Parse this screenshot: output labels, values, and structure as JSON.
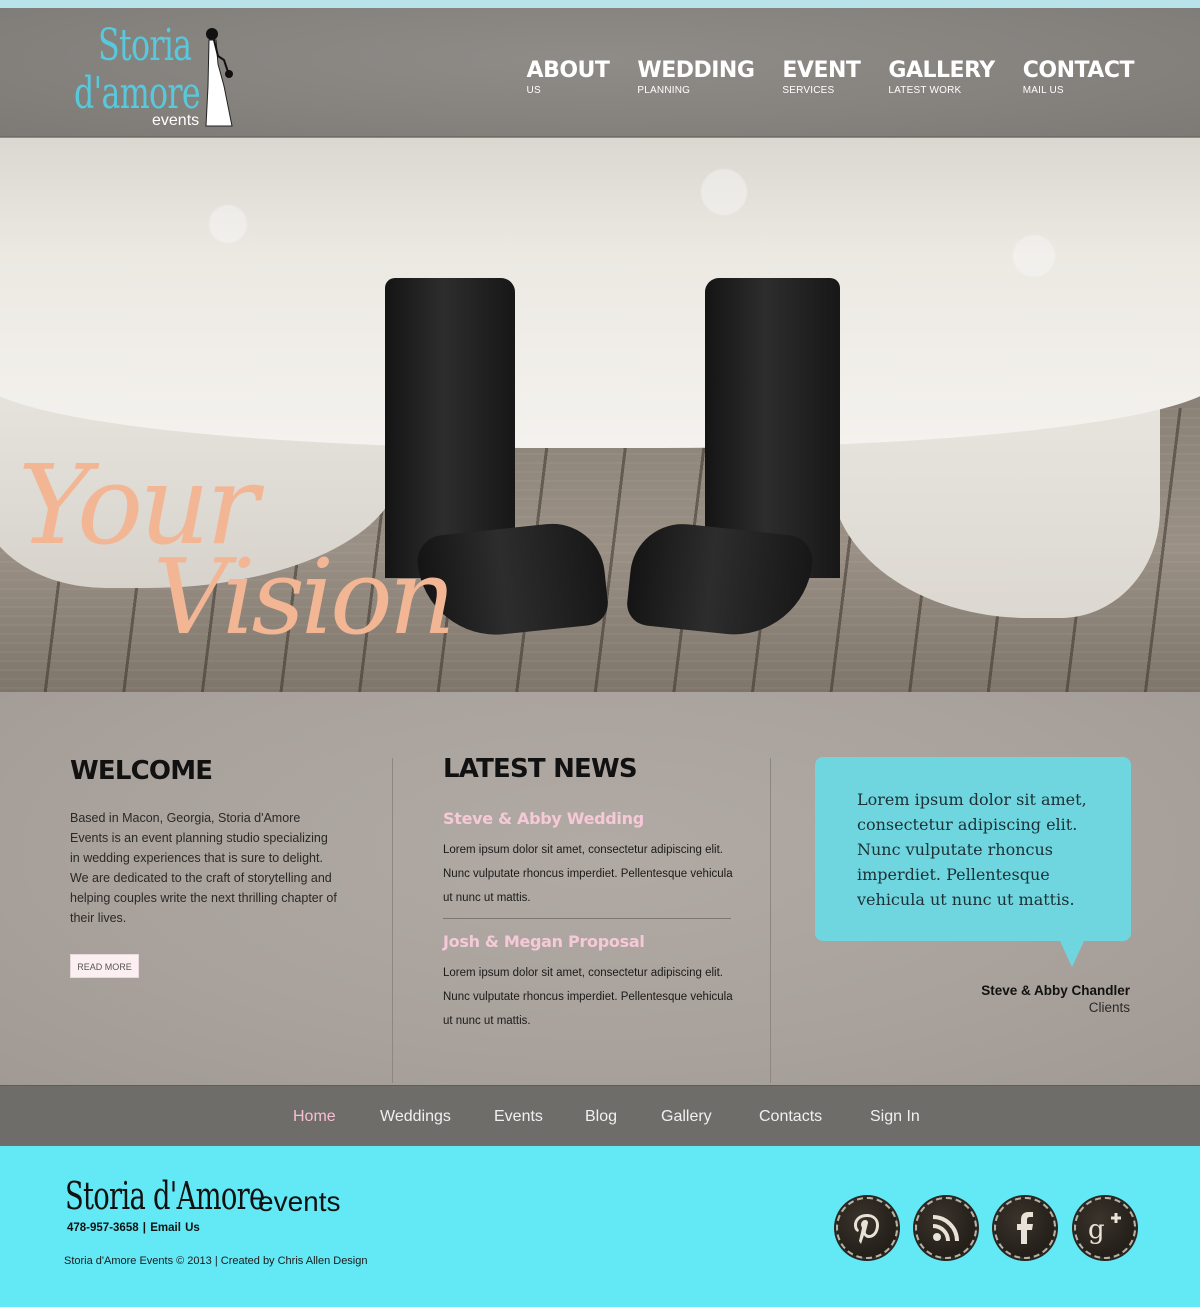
{
  "header": {
    "logo": {
      "line1": "Storia",
      "line2": "d'amore",
      "line3": "events"
    },
    "nav": [
      {
        "label": "ABOUT",
        "sub": "US"
      },
      {
        "label": "WEDDING",
        "sub": "PLANNING"
      },
      {
        "label": "EVENT",
        "sub": "SERVICES"
      },
      {
        "label": "GALLERY",
        "sub": "LATEST WORK"
      },
      {
        "label": "CONTACT",
        "sub": "MAIL US"
      }
    ]
  },
  "hero": {
    "tagline_1": "Your",
    "tagline_2": "Vision"
  },
  "welcome": {
    "title": "WELCOME",
    "body": "Based in Macon, Georgia, Storia d'Amore Events is an event planning studio specializing in wedding experiences that is sure to delight. We are dedicated to the craft of storytelling and helping couples write the next thrilling chapter of their lives.",
    "button": "READ MORE"
  },
  "news": {
    "title": "LATEST NEWS",
    "items": [
      {
        "title": "Steve & Abby Wedding",
        "body": "Lorem ipsum dolor sit amet, consectetur adipiscing elit. Nunc vulputate rhoncus imperdiet.  Pellentesque vehicula ut nunc ut mattis."
      },
      {
        "title": "Josh & Megan Proposal",
        "body": "Lorem ipsum dolor sit amet, consectetur adipiscing elit. Nunc vulputate rhoncus imperdiet.  Pellentesque vehicula ut nunc ut mattis."
      }
    ]
  },
  "testimonial": {
    "quote": "Lorem ipsum dolor sit amet, consectetur adipiscing elit. Nunc vulputate rhoncus imperdiet.  Pellentesque vehicula ut nunc ut mattis.",
    "name": "Steve & Abby Chandler",
    "role": "Clients"
  },
  "bottom_nav": {
    "items": [
      "Home",
      "Weddings",
      "Events",
      "Blog",
      "Gallery",
      "Contacts",
      "Sign In"
    ],
    "active": "Home"
  },
  "footer": {
    "logo": "Storia d'Amore",
    "logo_suffix": "events",
    "contact": "478-957-3658  |  Email Us",
    "copyright": "Storia d'Amore Events © 2013 | Created by Chris Allen Design",
    "social": [
      "pinterest-icon",
      "rss-icon",
      "facebook-icon",
      "google-plus-icon"
    ]
  },
  "colors": {
    "accent_blue": "#63e8f5",
    "bubble": "#6fd6e0",
    "pink": "#f6c9d8",
    "tagline_peach": "#f3b695",
    "logo_blue": "#57c9dc"
  }
}
